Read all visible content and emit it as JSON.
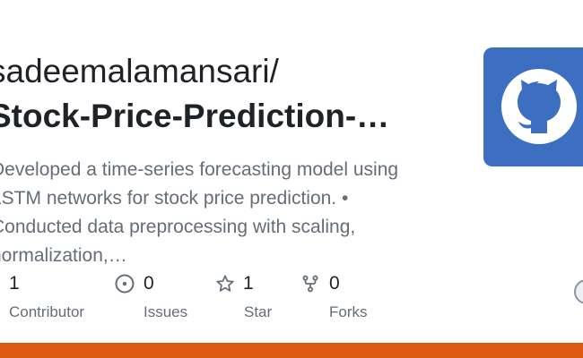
{
  "repo": {
    "owner": "sadeemalamansari/",
    "name": "Stock-Price-Prediction-…"
  },
  "description": {
    "lines": [
      "Developed a time-series forecasting model using",
      "LSTM networks for stock price prediction. •",
      "Conducted data preprocessing with scaling,",
      "normalization,…"
    ]
  },
  "stats": {
    "contributors": {
      "count": "1",
      "label": "Contributor",
      "icon": "people-icon"
    },
    "issues": {
      "count": "0",
      "label": "Issues",
      "icon": "issue-icon"
    },
    "stars": {
      "count": "1",
      "label": "Star",
      "icon": "star-icon"
    },
    "forks": {
      "count": "0",
      "label": "Forks",
      "icon": "fork-icon"
    }
  },
  "colors": {
    "logo_bg": "#3c6fc1",
    "footer_bar": "#de5a10",
    "text_primary": "#1f2328",
    "text_secondary": "#656d76"
  }
}
